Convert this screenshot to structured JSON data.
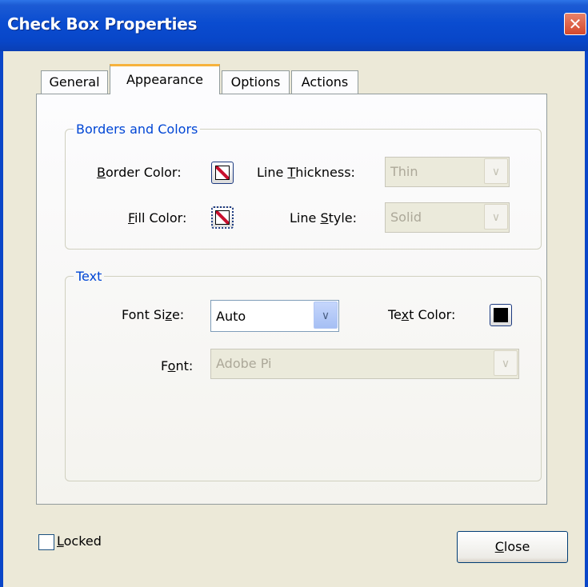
{
  "window": {
    "title": "Check Box Properties",
    "close_glyph": "✕"
  },
  "tabs": [
    {
      "label": "General",
      "active": false
    },
    {
      "label": "Appearance",
      "active": true
    },
    {
      "label": "Options",
      "active": false
    },
    {
      "label": "Actions",
      "active": false
    }
  ],
  "borders_colors": {
    "legend": "Borders and Colors",
    "border_color_label": "Border Color:",
    "fill_color_label": "Fill Color:",
    "line_thickness_label": "Line Thickness:",
    "line_thickness_value": "Thin",
    "line_style_label": "Line Style:",
    "line_style_value": "Solid"
  },
  "text_section": {
    "legend": "Text",
    "font_size_label": "Font Size:",
    "font_size_value": "Auto",
    "text_color_label": "Text Color:",
    "text_color": "#000000",
    "font_label": "Font:",
    "font_value": "Adobe Pi"
  },
  "footer": {
    "locked_label": "Locked",
    "locked_checked": false,
    "close_label": "Close"
  },
  "colors": {
    "accent_title": "#0a4cd0",
    "legend_text": "#0046d5",
    "active_tab_highlight": "#f6b23c"
  }
}
